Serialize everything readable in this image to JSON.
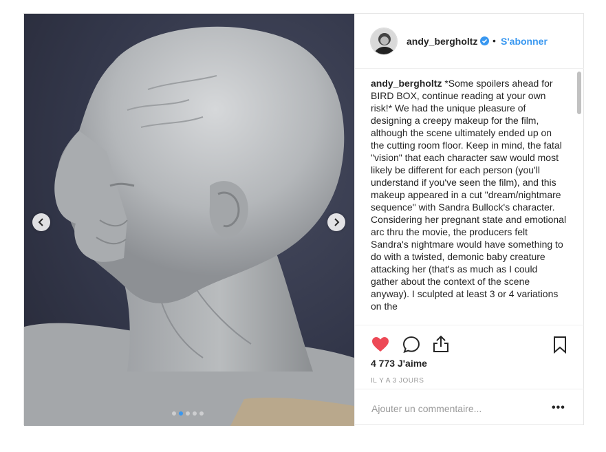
{
  "post": {
    "username": "andy_bergholtz",
    "separator": "•",
    "follow_label": "S'abonner",
    "caption_user": "andy_bergholtz",
    "caption_text": " *Some spoilers ahead for BIRD BOX, continue reading at your own risk!* We had the unique pleasure of designing a creepy makeup for the film, although the scene ultimately ended up on the cutting room floor. Keep in mind, the fatal \"vision\" that each character saw would most likely be different for each person (you'll understand if you've seen the film), and this makeup appeared in a cut \"dream/nightmare sequence\" with Sandra Bullock's character.",
    "caption_text_2": "Considering her pregnant state and emotional arc thru the movie, the producers felt Sandra's nightmare would have something to do with a twisted, demonic baby creature attacking her (that's as much as I could gather about the context of the scene anyway). I sculpted at least 3 or 4 variations on the",
    "likes": "4 773 J'aime",
    "time": "IL Y A 3 JOURS",
    "comment_placeholder": "Ajouter un commentaire...",
    "more_label": "•••"
  },
  "carousel": {
    "slide_count": 5,
    "active_index": 1
  },
  "icons": {
    "like": "heart-icon",
    "comment": "comment-icon",
    "share": "share-icon",
    "save": "bookmark-icon",
    "prev": "chevron-left-icon",
    "next": "chevron-right-icon",
    "verified": "verified-badge-icon"
  },
  "colors": {
    "accent": "#3897f0",
    "like": "#ed4956",
    "border": "#efefef"
  }
}
